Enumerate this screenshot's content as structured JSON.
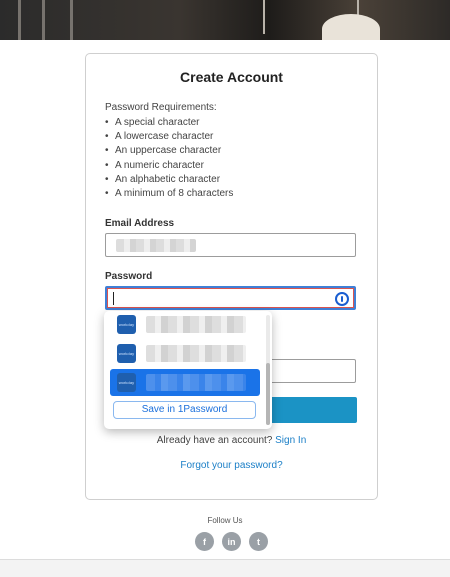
{
  "card": {
    "title": "Create Account",
    "requirements_title": "Password Requirements:",
    "requirements": [
      "A special character",
      "A lowercase character",
      "An uppercase character",
      "A numeric character",
      "An alphabetic character",
      "A minimum of 8 characters"
    ],
    "email_label": "Email Address",
    "password_label": "Password",
    "have_account_text": "Already have an account?",
    "sign_in_link": "Sign In",
    "forgot_link": "Forgot your password?"
  },
  "password_manager_popup": {
    "logo_text": "workday",
    "save_button": "Save in 1Password",
    "items": [
      {
        "selected": false
      },
      {
        "selected": false
      },
      {
        "selected": true
      }
    ]
  },
  "footer": {
    "follow_label": "Follow Us",
    "socials": [
      {
        "name": "facebook-icon",
        "glyph": "f"
      },
      {
        "name": "linkedin-icon",
        "glyph": "in"
      },
      {
        "name": "twitter-icon",
        "glyph": "t"
      }
    ]
  },
  "colors": {
    "accent": "#1b93c5",
    "link": "#1b7fc7",
    "focus": "#3f7fd6",
    "selected_row": "#1a73e8"
  }
}
